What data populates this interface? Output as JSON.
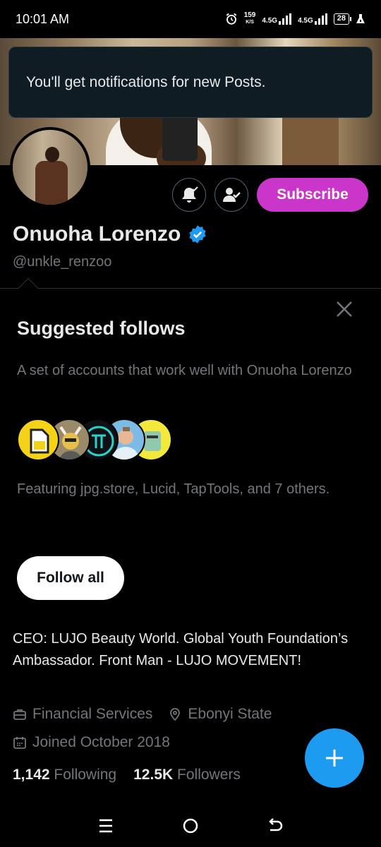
{
  "status_bar": {
    "time": "10:01 AM",
    "net_speed_value": "159",
    "net_speed_unit": "K/S",
    "signal1_label": "4.5G",
    "signal2_label": "4.5G",
    "battery": "28"
  },
  "toast": {
    "message": "You'll get notifications for new Posts."
  },
  "profile": {
    "name": "Onuoha Lorenzo",
    "handle": "@unkle_renzoo",
    "subscribe_label": "Subscribe",
    "verified_color": "#1d9bf0"
  },
  "suggested_follows": {
    "title": "Suggested follows",
    "description": "A set of accounts that work well with Onuoha Lorenzo",
    "featuring": "Featuring jpg.store, Lucid, TapTools, and 7 others.",
    "follow_all_label": "Follow all"
  },
  "bio": "CEO: LUJO Beauty World. Global Youth Foundation’s Ambassador. Front Man - LUJO MOVEMENT!",
  "meta": {
    "category": "Financial Services",
    "location": "Ebonyi State",
    "joined": "Joined October 2018"
  },
  "stats": {
    "following_count": "1,142",
    "following_label": "Following",
    "followers_count": "12.5K",
    "followers_label": "Followers"
  },
  "colors": {
    "accent": "#1d9bf0",
    "subscribe": "#c936c9",
    "muted_text": "#71767b"
  }
}
